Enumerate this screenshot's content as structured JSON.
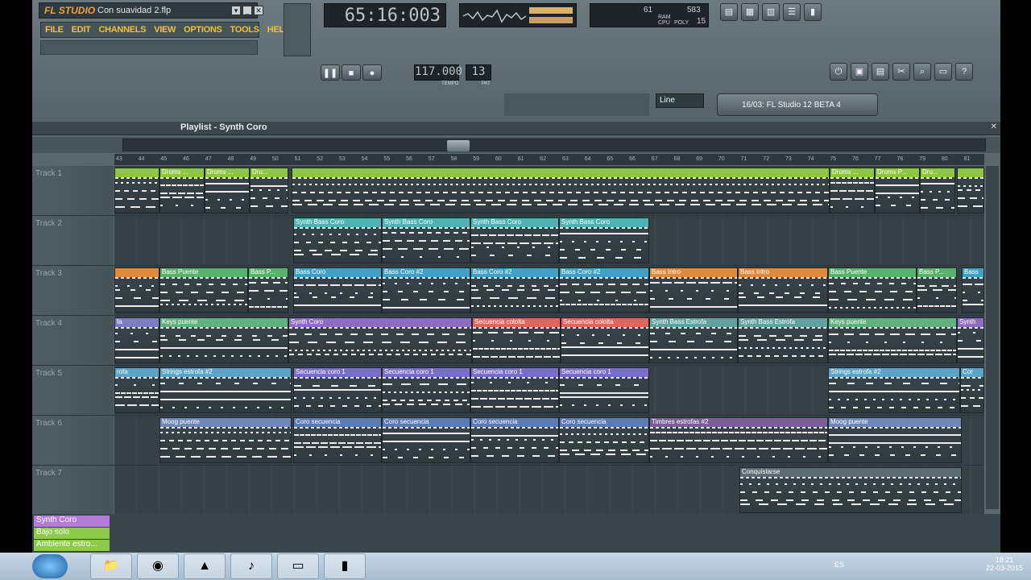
{
  "window": {
    "app": "FL STUDIO",
    "project": "Con suavidad 2.flp"
  },
  "menu": [
    "FILE",
    "EDIT",
    "CHANNELS",
    "VIEW",
    "OPTIONS",
    "TOOLS",
    "HELP"
  ],
  "clock": "65:16:003",
  "cpu": {
    "ram": "61",
    "poly": "583",
    "cpu_label": "CPU",
    "poly_label": "POLY",
    "ram_label": "RAM",
    "poly_value": "15"
  },
  "tempo": "117.000",
  "pattern": "13",
  "tempo_label": "TEMPO",
  "pat_label": "PAT",
  "snap": "Line",
  "hint": "16/03: FL Studio 12 BETA 4",
  "playlist_title": "Playlist - Synth Coro",
  "ruler": [
    "43",
    "44",
    "45",
    "46",
    "47",
    "48",
    "49",
    "50",
    "51",
    "52",
    "53",
    "54",
    "55",
    "56",
    "57",
    "58",
    "59",
    "60",
    "61",
    "62",
    "63",
    "64",
    "65",
    "66",
    "67",
    "68",
    "69",
    "70",
    "71",
    "72",
    "73",
    "74",
    "75",
    "76",
    "77",
    "78",
    "79",
    "80",
    "81"
  ],
  "tracks": [
    {
      "name": "Track 1",
      "clips": [
        {
          "label": "",
          "start": 0,
          "len": 56,
          "color": "#8dc63f"
        },
        {
          "label": "Drums ...",
          "start": 56,
          "len": 56,
          "color": "#8dc63f"
        },
        {
          "label": "Drums ...",
          "start": 112,
          "len": 56,
          "color": "#8dc63f"
        },
        {
          "label": "Dru...",
          "start": 168,
          "len": 48,
          "color": "#8dc63f"
        },
        {
          "label": "",
          "start": 220,
          "len": 668,
          "color": "#8dc63f"
        },
        {
          "label": "Drums ...",
          "start": 888,
          "len": 56,
          "color": "#8dc63f"
        },
        {
          "label": "Drums P...",
          "start": 944,
          "len": 56,
          "color": "#8dc63f"
        },
        {
          "label": "Dru...",
          "start": 1000,
          "len": 44,
          "color": "#8dc63f"
        },
        {
          "label": "",
          "start": 1046,
          "len": 34,
          "color": "#8dc63f"
        }
      ]
    },
    {
      "name": "Track 2",
      "clips": [
        {
          "label": "Synth Bass Coro",
          "start": 222,
          "len": 110,
          "color": "#4fb3b3"
        },
        {
          "label": "Synth Bass Coro",
          "start": 332,
          "len": 110,
          "color": "#4fb3b3"
        },
        {
          "label": "Synth Bass Coro",
          "start": 442,
          "len": 110,
          "color": "#4fb3b3"
        },
        {
          "label": "Synth Bass Coro",
          "start": 552,
          "len": 112,
          "color": "#4fb3b3"
        }
      ]
    },
    {
      "name": "Track 3",
      "clips": [
        {
          "label": "",
          "start": 0,
          "len": 56,
          "color": "#e0893a"
        },
        {
          "label": "Bass Puente",
          "start": 56,
          "len": 110,
          "color": "#57b36b"
        },
        {
          "label": "Bass P...",
          "start": 166,
          "len": 50,
          "color": "#57b36b"
        },
        {
          "label": "Bass Coro",
          "start": 222,
          "len": 110,
          "color": "#3fa2c4"
        },
        {
          "label": "Bass Coro #2",
          "start": 332,
          "len": 110,
          "color": "#3fa2c4"
        },
        {
          "label": "Bass Coro #2",
          "start": 442,
          "len": 110,
          "color": "#3fa2c4"
        },
        {
          "label": "Bass Coro #2",
          "start": 552,
          "len": 112,
          "color": "#3fa2c4"
        },
        {
          "label": "Bass Intro",
          "start": 664,
          "len": 110,
          "color": "#e0893a"
        },
        {
          "label": "Bass Intro",
          "start": 774,
          "len": 112,
          "color": "#e0893a"
        },
        {
          "label": "Bass Puente",
          "start": 886,
          "len": 110,
          "color": "#57b36b"
        },
        {
          "label": "Bass P...",
          "start": 996,
          "len": 50,
          "color": "#57b36b"
        },
        {
          "label": "Bass",
          "start": 1052,
          "len": 28,
          "color": "#3fa2c4"
        }
      ]
    },
    {
      "name": "Track 4",
      "clips": [
        {
          "label": "fa",
          "start": 0,
          "len": 56,
          "color": "#7d7dc4"
        },
        {
          "label": "Keys puente",
          "start": 56,
          "len": 160,
          "color": "#63b07f"
        },
        {
          "label": "Synth Coro",
          "start": 216,
          "len": 228,
          "color": "#8f6bc4"
        },
        {
          "label": "Secuencia cololta",
          "start": 444,
          "len": 110,
          "color": "#d9695e"
        },
        {
          "label": "Secuencia cololta",
          "start": 554,
          "len": 110,
          "color": "#d9695e"
        },
        {
          "label": "Synth Bass Estrofa",
          "start": 664,
          "len": 110,
          "color": "#63a0a0"
        },
        {
          "label": "Synth Bass Estrofa",
          "start": 774,
          "len": 112,
          "color": "#63a0a0"
        },
        {
          "label": "Keys puente",
          "start": 886,
          "len": 160,
          "color": "#63b07f"
        },
        {
          "label": "Synth",
          "start": 1046,
          "len": 34,
          "color": "#8f6bc4"
        }
      ]
    },
    {
      "name": "Track 5",
      "clips": [
        {
          "label": "rofa",
          "start": 0,
          "len": 56,
          "color": "#5ba3c8"
        },
        {
          "label": "Strings estrofa #2",
          "start": 56,
          "len": 164,
          "color": "#5ba3c8"
        },
        {
          "label": "Secuencia coro 1",
          "start": 222,
          "len": 110,
          "color": "#7a6fc8"
        },
        {
          "label": "Secuencia coro 1",
          "start": 332,
          "len": 110,
          "color": "#7a6fc8"
        },
        {
          "label": "Secuencia coro 1",
          "start": 442,
          "len": 110,
          "color": "#7a6fc8"
        },
        {
          "label": "Secuencia coro 1",
          "start": 552,
          "len": 112,
          "color": "#7a6fc8"
        },
        {
          "label": "Strings estrofa #2",
          "start": 886,
          "len": 164,
          "color": "#5ba3c8"
        },
        {
          "label": "Cor",
          "start": 1050,
          "len": 30,
          "color": "#5ba3c8"
        }
      ]
    },
    {
      "name": "Track 6",
      "clips": [
        {
          "label": "Moog puente",
          "start": 56,
          "len": 164,
          "color": "#6e86b8"
        },
        {
          "label": "Coro secuencia",
          "start": 222,
          "len": 110,
          "color": "#5a7ab8"
        },
        {
          "label": "Coro secuencia",
          "start": 332,
          "len": 110,
          "color": "#5a7ab8"
        },
        {
          "label": "Coro secuencia",
          "start": 442,
          "len": 110,
          "color": "#5a7ab8"
        },
        {
          "label": "Coro secuencia",
          "start": 552,
          "len": 112,
          "color": "#5a7ab8"
        },
        {
          "label": "Timbres estrofas #2",
          "start": 664,
          "len": 222,
          "color": "#7a5f9c"
        },
        {
          "label": "Moog puente",
          "start": 886,
          "len": 166,
          "color": "#6e86b8"
        }
      ]
    },
    {
      "name": "Track 7",
      "clips": [
        {
          "label": "Conquistarse",
          "start": 776,
          "len": 276,
          "color": "#5d6c72"
        }
      ]
    }
  ],
  "patterns": [
    {
      "name": "Synth Coro",
      "color": "#b47cd8"
    },
    {
      "name": "Bajo solo",
      "color": "#8ccc4a"
    },
    {
      "name": "Ambiente estro...",
      "color": "#8ccc4a"
    }
  ],
  "taskbar": {
    "apps": [
      "folder",
      "chrome",
      "vlc",
      "fl-studio",
      "notes",
      "app"
    ],
    "time": "18:21",
    "date": "22-03-2015",
    "lang": "ES"
  }
}
